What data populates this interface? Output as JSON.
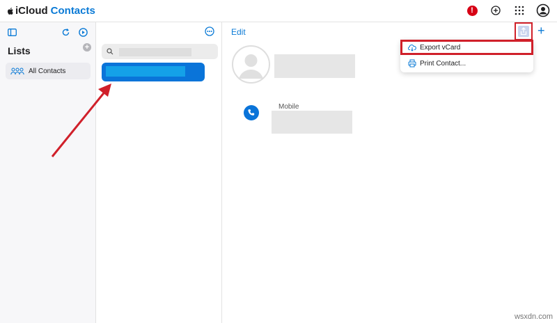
{
  "header": {
    "brand_prefix": "iCloud",
    "brand_app": "Contacts",
    "icons": [
      "apple-logo",
      "alert-icon",
      "add-circle-icon",
      "grid-icon",
      "account-icon"
    ],
    "alert_badge": "!"
  },
  "sidebar": {
    "lists_title": "Lists",
    "add_symbol": "+",
    "items": [
      {
        "label": "All Contacts",
        "icon": "group-icon"
      }
    ]
  },
  "list_pane": {
    "search_placeholder": "",
    "selected_contact_redacted": true
  },
  "detail": {
    "edit_label": "Edit",
    "add_symbol": "+",
    "mobile_label": "Mobile"
  },
  "share_menu": {
    "items": [
      {
        "label": "Export vCard",
        "icon": "cloud-download-icon",
        "highlighted": true
      },
      {
        "label": "Print Contact...",
        "icon": "printer-icon",
        "highlighted": false
      }
    ]
  },
  "watermark": "wsxdn.com",
  "colors": {
    "accent": "#0a7ad6",
    "selection": "#0a74d9",
    "highlight_box": "#d0202a",
    "alert": "#d70015"
  }
}
